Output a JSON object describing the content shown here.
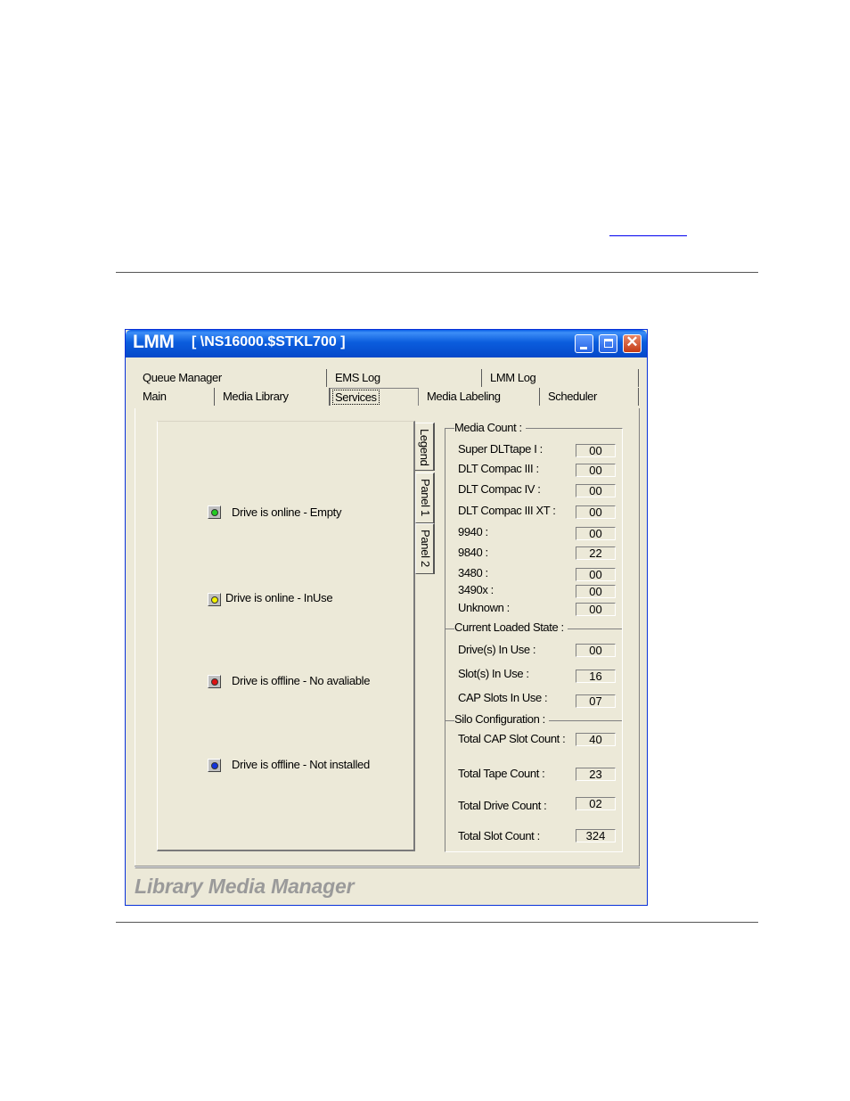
{
  "window": {
    "app_name": "LMM",
    "path": "[ \\NS16000.$STKL700 ]"
  },
  "tabs_row1": [
    "Queue Manager",
    "EMS Log",
    "LMM Log"
  ],
  "tabs_row2": [
    "Main",
    "Media Library",
    "Services",
    "Media Labeling",
    "Scheduler"
  ],
  "active_tab": "Services",
  "side_tabs": [
    "Legend",
    "Panel 1",
    "Panel 2"
  ],
  "legend": [
    {
      "label": "Drive is online - Empty",
      "color": "#22cc22"
    },
    {
      "label": "Drive is online - InUse",
      "color": "#f2f200"
    },
    {
      "label": "Drive is offline - No avaliable",
      "color": "#dd1111"
    },
    {
      "label": "Drive is offline - Not installed",
      "color": "#1133dd"
    }
  ],
  "media_count": {
    "header": "Media Count :",
    "rows": [
      {
        "label": "Super DLTtape I :",
        "value": "00"
      },
      {
        "label": "DLT Compac III :",
        "value": "00"
      },
      {
        "label": "DLT Compac IV :",
        "value": "00"
      },
      {
        "label": "DLT Compac III XT :",
        "value": "00"
      },
      {
        "label": "9940 :",
        "value": "00"
      },
      {
        "label": "9840 :",
        "value": "22"
      },
      {
        "label": "3480 :",
        "value": "00"
      },
      {
        "label": "3490x :",
        "value": "00"
      },
      {
        "label": "Unknown :",
        "value": "00"
      }
    ]
  },
  "loaded_state": {
    "header": "Current Loaded State :",
    "rows": [
      {
        "label": "Drive(s) In Use :",
        "value": "00"
      },
      {
        "label": "Slot(s) In Use :",
        "value": "16"
      },
      {
        "label": "CAP Slots In Use :",
        "value": "07"
      }
    ]
  },
  "silo_config": {
    "header": "Silo Configuration :",
    "rows": [
      {
        "label": "Total CAP Slot Count :",
        "value": "40"
      },
      {
        "label": "Total Tape Count :",
        "value": "23"
      },
      {
        "label": "Total Drive Count :",
        "value": "02"
      },
      {
        "label": "Total Slot Count :",
        "value": "324"
      }
    ]
  },
  "footer": "Library Media Manager"
}
